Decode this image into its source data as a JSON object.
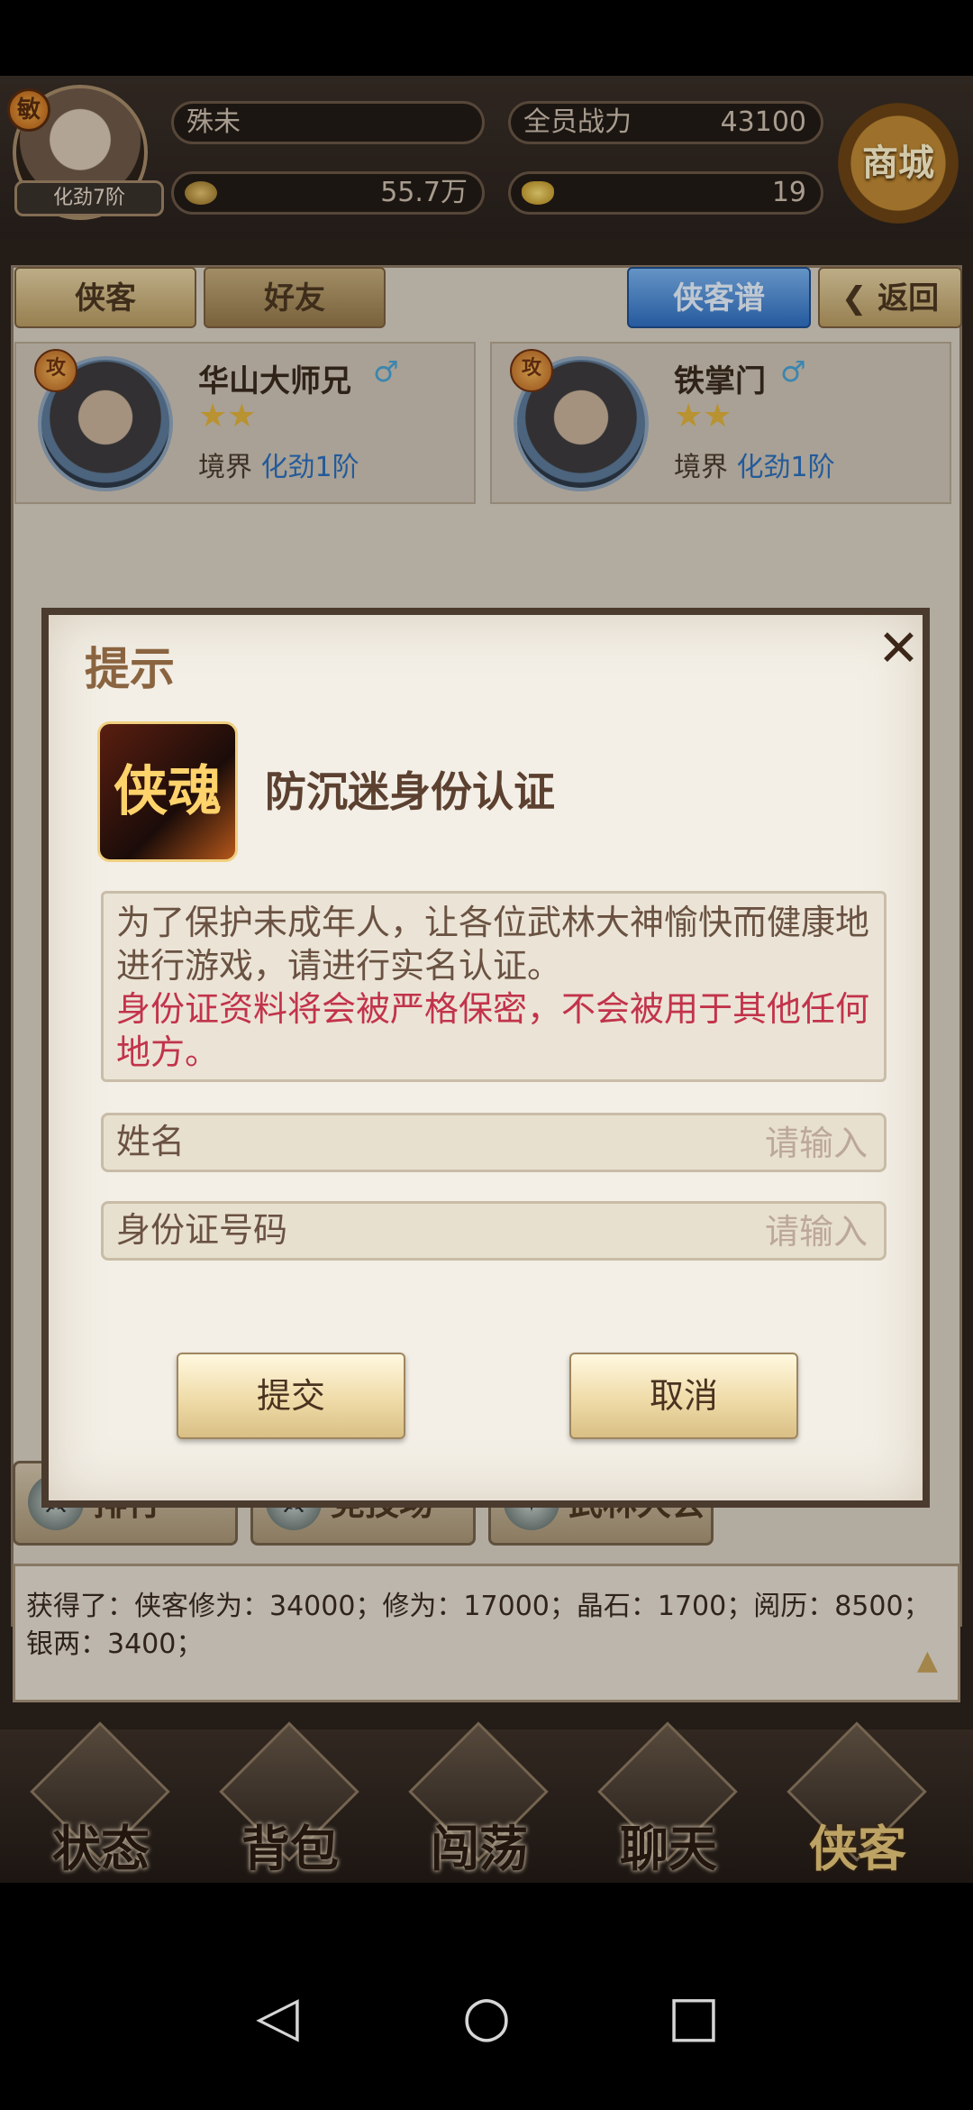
{
  "player": {
    "name": "殊未",
    "level_badge": "敏",
    "realm": "化劲7阶",
    "power_label": "全员战力",
    "power_value": "43100",
    "silver": "55.7万",
    "gold": "19",
    "shop_label": "商城"
  },
  "tabs": {
    "heroes": "侠客",
    "friends": "好友",
    "codex": "侠客谱",
    "back": "返回"
  },
  "cards": [
    {
      "name": "华山大师兄",
      "badge": "攻",
      "realm_label": "境界",
      "realm_value": "化劲1阶",
      "stars": "★★"
    },
    {
      "name": "铁掌门",
      "badge": "攻",
      "realm_label": "境界",
      "realm_value": "化劲1阶",
      "stars": "★★"
    }
  ],
  "dialog": {
    "title": "提示",
    "close": "✕",
    "app_icon_text": "侠魂",
    "auth_title": "防沉迷身份认证",
    "notice_line1": "为了保护未成年人，让各位武林大神愉快而健康地进行游戏，请进行实名认证。",
    "notice_red": "身份证资料将会被严格保密，不会被用于其他任何地方。",
    "name_label": "姓名",
    "name_placeholder": "请输入",
    "id_label": "身份证号码",
    "id_placeholder": "请输入",
    "submit": "提交",
    "cancel": "取消"
  },
  "modes": {
    "rank": "排行",
    "arena": "竞技场",
    "tournament": "武林大会"
  },
  "log": {
    "line1": "获得了：侠客修为：34000；修为：17000；晶石：1700；阅历：8500；",
    "line2": "银两：3400；"
  },
  "bottom_nav": [
    "状态",
    "背包",
    "闯荡",
    "聊天",
    "侠客"
  ],
  "system_nav": {
    "back": "◁",
    "home": "○",
    "recents": "□"
  }
}
